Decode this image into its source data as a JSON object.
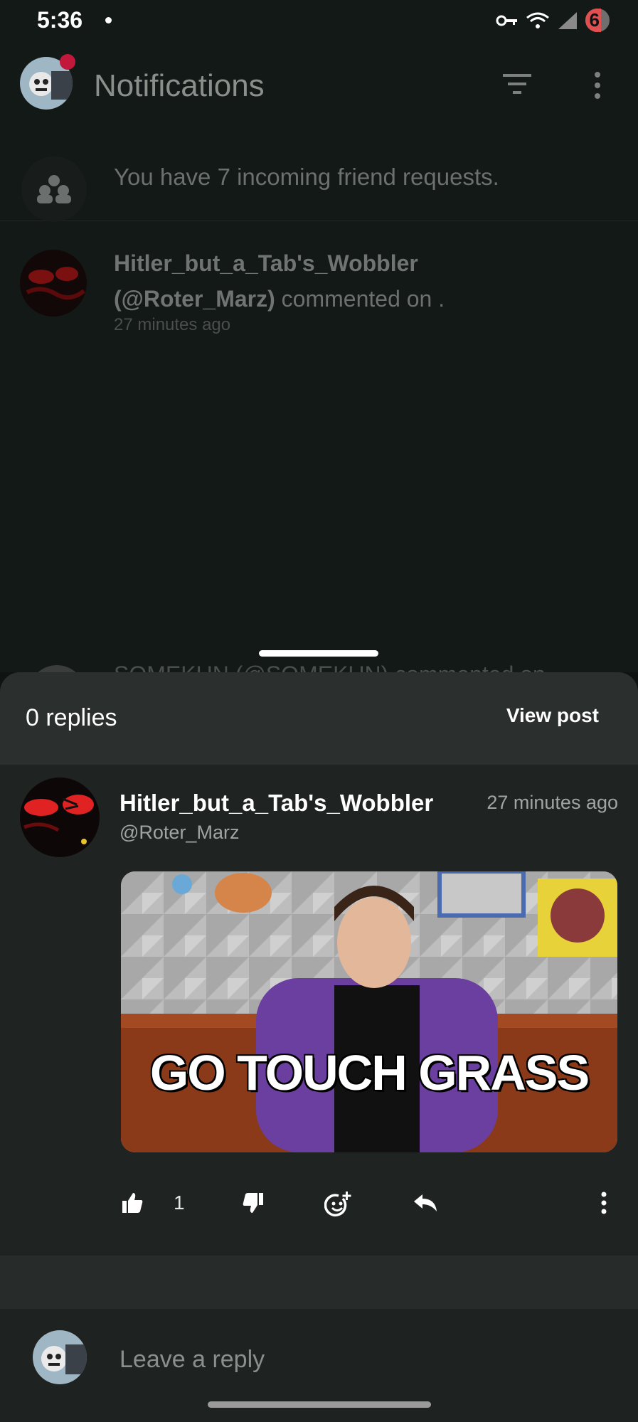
{
  "status_bar": {
    "time": "5:36",
    "battery": "6"
  },
  "appbar": {
    "title": "Notifications"
  },
  "friend_requests": {
    "text": "You have 7 incoming friend requests."
  },
  "notification": {
    "name_line1": "Hitler_but_a_Tab's_Wobbler",
    "name_line2": "(@Roter_Marz)",
    "action": "commented on .",
    "time": "27 minutes ago"
  },
  "peek": {
    "text": "SOMEKUN (@SOMEKUN) commented on"
  },
  "sheet": {
    "replies": "0 replies",
    "view_post": "View post",
    "comment": {
      "author": "Hitler_but_a_Tab's_Wobbler",
      "handle": "@Roter_Marz",
      "time": "27 minutes ago",
      "gif_caption": "GO TOUCH GRASS",
      "like_count": "1"
    },
    "reply_placeholder": "Leave a reply"
  }
}
